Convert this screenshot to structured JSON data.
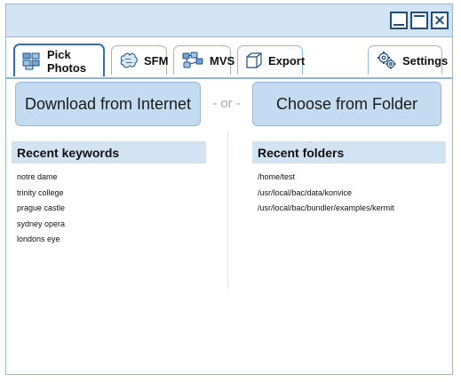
{
  "window": {
    "controls": {
      "minimize": "minimize",
      "maximize": "maximize",
      "close": "×"
    }
  },
  "tabs": [
    {
      "id": "pick",
      "label": "Pick Photos",
      "icon": "photos-grid-icon",
      "active": true
    },
    {
      "id": "sfm",
      "label": "SFM",
      "icon": "brain-icon",
      "active": false
    },
    {
      "id": "mvs",
      "label": "MVS",
      "icon": "network-icon",
      "active": false
    },
    {
      "id": "export",
      "label": "Export",
      "icon": "cube-icon",
      "active": false
    },
    {
      "id": "settings",
      "label": "Settings",
      "icon": "gears-icon",
      "active": false
    }
  ],
  "actions": {
    "download_label": "Download from Internet",
    "or_label": "- or -",
    "folder_label": "Choose from Folder"
  },
  "recent_keywords": {
    "title": "Recent keywords",
    "items": [
      "notre dame",
      "trinity college",
      "prague castle",
      "sydney opera",
      "londons eye"
    ]
  },
  "recent_folders": {
    "title": "Recent folders",
    "items": [
      "/home/test",
      "/usr/local/bac/data/konvice",
      "/usr/local/bac/bundler/examples/kermit"
    ]
  },
  "colors": {
    "accent": "#2f6fb3",
    "panel": "#d2e3f3",
    "button": "#c3dcf2",
    "border": "#9ab8d6"
  }
}
